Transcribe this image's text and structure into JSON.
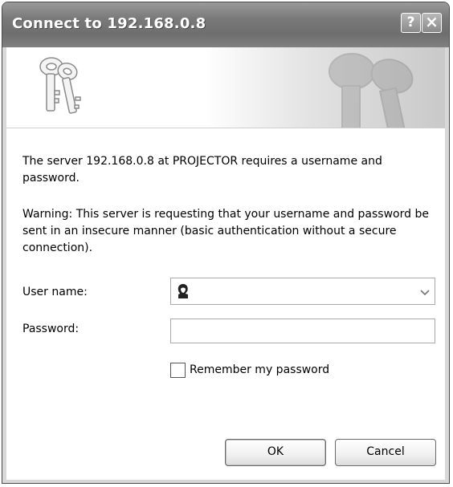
{
  "window": {
    "title": "Connect to 192.168.0.8",
    "help_glyph": "?",
    "close_glyph": "×"
  },
  "icons": {
    "banner": "keys-icon",
    "watermark": "keys-watermark-icon",
    "user": "user-icon",
    "dropdown": "chevron-down-icon"
  },
  "message": {
    "line1": "The server 192.168.0.8 at PROJECTOR requires a username and password.",
    "warning": "Warning: This server is requesting that your username and password be sent in an insecure manner (basic authentication without a secure connection)."
  },
  "form": {
    "username_label": "User name:",
    "username_value": "",
    "password_label": "Password:",
    "password_value": "",
    "remember_label": "Remember my password",
    "remember_checked": false
  },
  "buttons": {
    "ok": "OK",
    "cancel": "Cancel"
  }
}
